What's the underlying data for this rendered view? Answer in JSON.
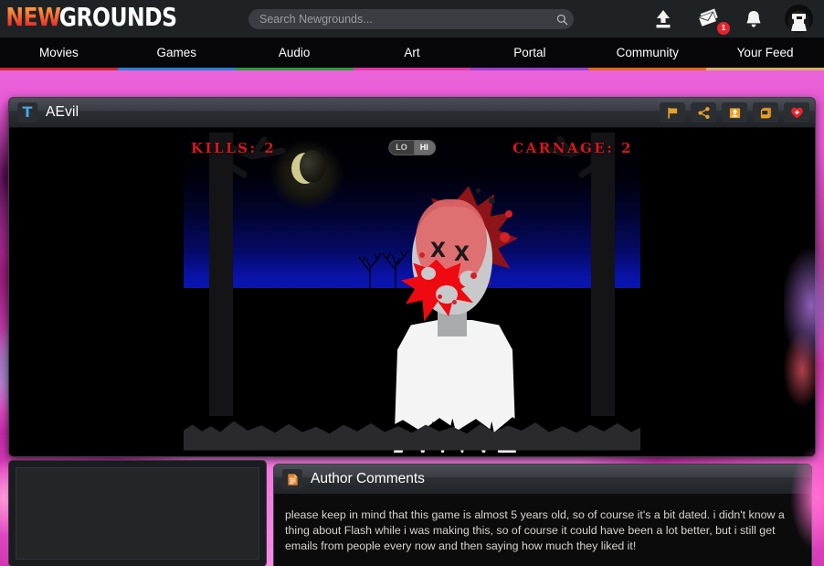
{
  "site": {
    "logo_new": "NEW",
    "logo_grounds": "GROUNDS"
  },
  "search": {
    "placeholder": "Search Newgrounds...",
    "value": "",
    "icon": "search-icon"
  },
  "header_icons": [
    {
      "name": "upload-icon",
      "label": "Upload"
    },
    {
      "name": "mail-icon",
      "label": "Messages",
      "badge": "1"
    },
    {
      "name": "bell-icon",
      "label": "Notifications"
    },
    {
      "name": "avatar",
      "label": "Account"
    }
  ],
  "nav": {
    "items": [
      {
        "label": "Movies",
        "color": "#d1282e"
      },
      {
        "label": "Games",
        "color": "#2d7fd4"
      },
      {
        "label": "Audio",
        "color": "#2f9a3c"
      },
      {
        "label": "Art",
        "color": "#e238a8"
      },
      {
        "label": "Portal",
        "color": "#9a3fd0"
      },
      {
        "label": "Community",
        "color": "#e2681f"
      },
      {
        "label": "Your Feed",
        "color": "#d9b06a"
      }
    ]
  },
  "game": {
    "title": "AEvil",
    "rating_icon_label": "T",
    "actions": [
      {
        "name": "flag-icon",
        "label": "Flag"
      },
      {
        "name": "share-icon",
        "label": "Share"
      },
      {
        "name": "save-icon",
        "label": "Save"
      },
      {
        "name": "collections-icon",
        "label": "Collections"
      },
      {
        "name": "favorite-icon",
        "label": "Favorite"
      }
    ],
    "hud": {
      "kills_label": "KILLS:",
      "kills_value": "2",
      "carnage_label": "CARNAGE:",
      "carnage_value": "2"
    },
    "quality": {
      "low_label": "LO",
      "high_label": "HI",
      "selected": "HI"
    }
  },
  "comments": {
    "title": "Author Comments",
    "icon": "document-icon",
    "body": "please keep in mind that this game is almost 5 years old, so of course it's a bit dated. i didn't know a thing about Flash while i was making this, so of course it could have been a lot better, but i still get emails from people every now and then saying how much they liked it!"
  },
  "left_panel": {
    "content": ""
  }
}
